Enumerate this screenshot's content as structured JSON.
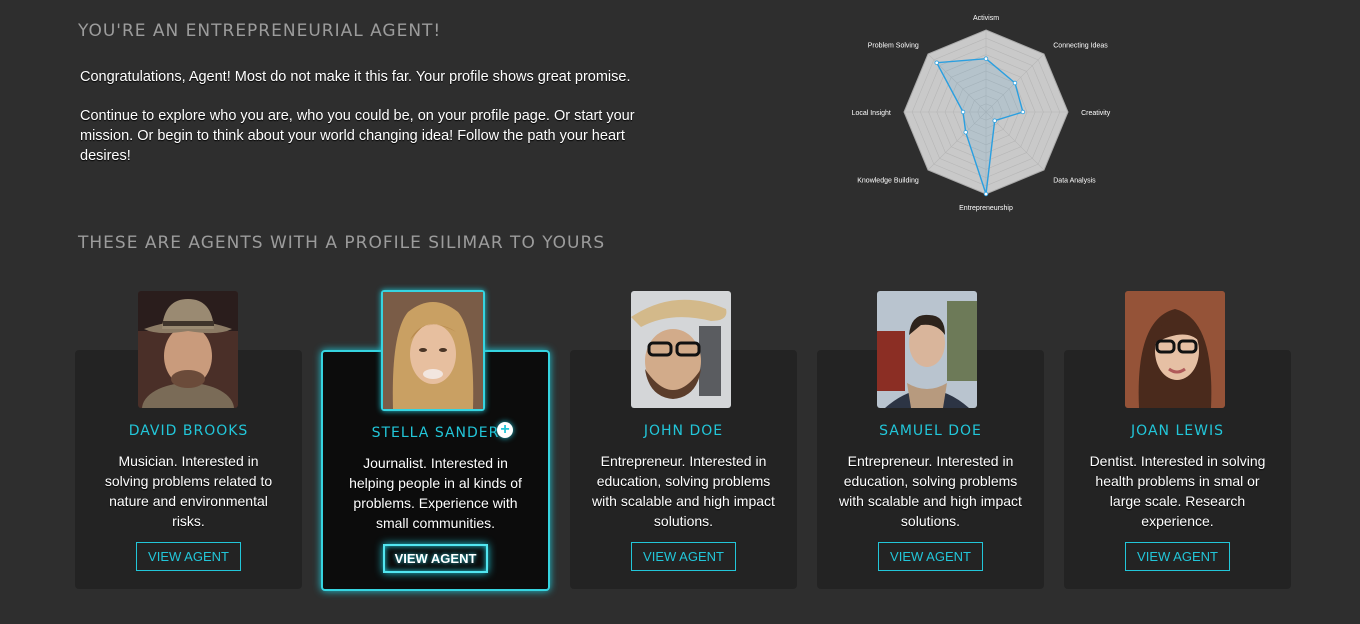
{
  "header": {
    "title": "YOU'RE AN ENTREPRENEURIAL AGENT!",
    "intro_1": "Congratulations, Agent!  Most do not make it this far. Your profile shows great promise.",
    "intro_2": "Continue to explore who you are, who you could be, on your profile page.  Or start your mission.  Or begin to think about your world changing idea!  Follow the path your heart desires!"
  },
  "radar": {
    "axes": [
      "Activism",
      "Connecting Ideas",
      "Creativity",
      "Data Analysis",
      "Entrepreneurship",
      "Knowledge Building",
      "Local Insight",
      "Problem Solving"
    ],
    "values": [
      0.65,
      0.5,
      0.45,
      0.15,
      1.0,
      0.35,
      0.28,
      0.85
    ],
    "scale_max": 1,
    "rings": 10,
    "line_color": "#2a9fe0",
    "fill_color": "#c9c9c9"
  },
  "section": {
    "title": "THESE ARE AGENTS WITH A PROFILE SILIMAR TO YOURS"
  },
  "agents": [
    {
      "name": "DAVID BROOKS",
      "desc": "Musician. Interested in solving problems related to nature and environmental risks.",
      "button": "VIEW AGENT"
    },
    {
      "name": "STELLA SANDER",
      "desc": "Journalist. Interested in helping people in al kinds of problems. Experience with small communities.",
      "button": "VIEW AGENT"
    },
    {
      "name": "JOHN DOE",
      "desc": "Entrepreneur. Interested in education, solving problems with scalable and high impact solutions.",
      "button": "VIEW AGENT"
    },
    {
      "name": "SAMUEL DOE",
      "desc": "Entrepreneur. Interested in education, solving problems with scalable and high impact solutions.",
      "button": "VIEW AGENT"
    },
    {
      "name": "JOAN LEWIS",
      "desc": "Dentist. Interested in solving health problems in smal or large scale. Research experience.",
      "button": "VIEW AGENT"
    }
  ],
  "icons": {
    "add": "plus-icon"
  },
  "colors": {
    "accent": "#22c6d9",
    "background": "#2e2e2e",
    "card": "#232323"
  }
}
